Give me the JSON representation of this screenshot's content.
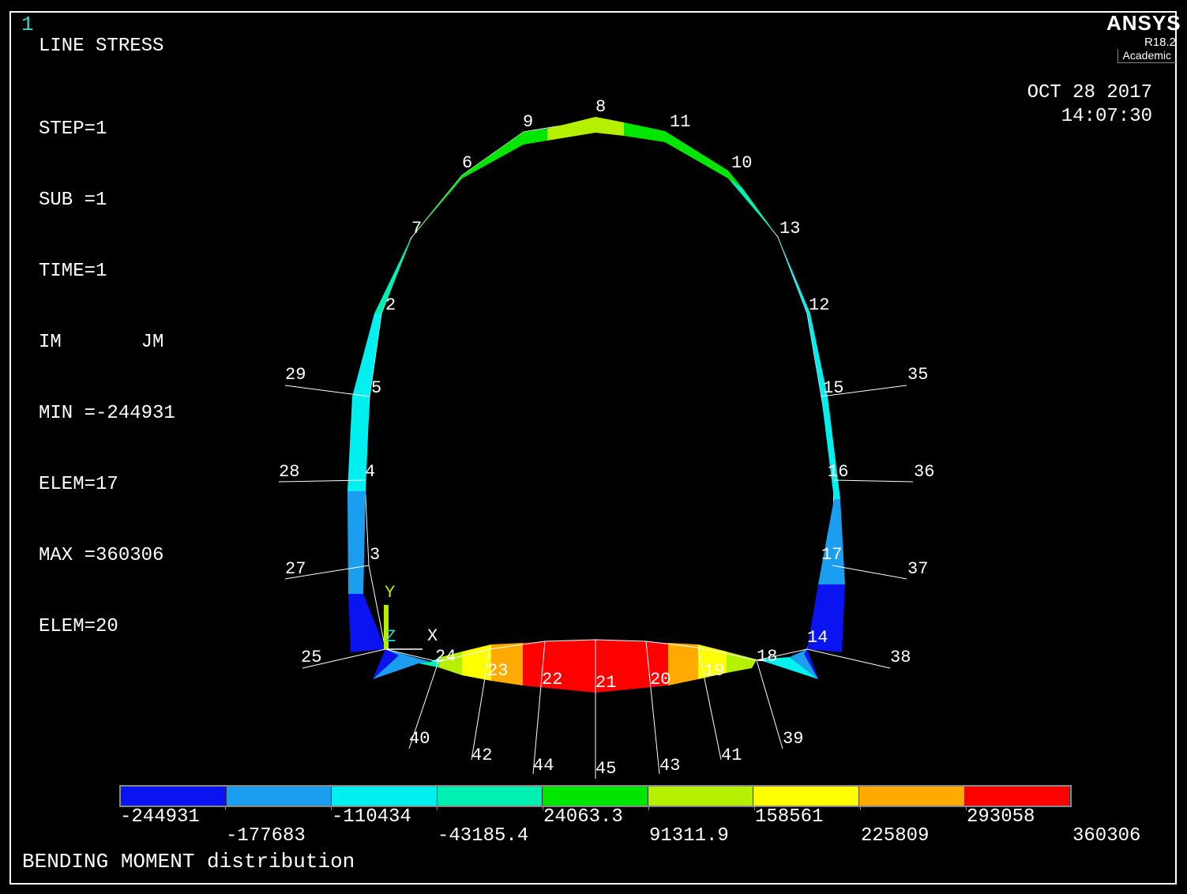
{
  "window_number": "1",
  "plot_title": "LINE STRESS",
  "info": {
    "step": "STEP=1",
    "sub": "SUB =1",
    "time": "TIME=1",
    "im_jm": "IM       JM",
    "min": "MIN =-244931",
    "min_elem": "ELEM=17",
    "max": "MAX =360306",
    "max_elem": "ELEM=20"
  },
  "date": "OCT 28 2017",
  "time": "14:07:30",
  "logo": {
    "name": "ANSYS",
    "version": "R18.2",
    "edition": "Academic"
  },
  "axis_triad": {
    "y": "Y",
    "z": "Z",
    "x": "X"
  },
  "legend": {
    "colors": [
      "#0a14f0",
      "#1c9ef0",
      "#00f0f0",
      "#00f0b4",
      "#00e600",
      "#b4f000",
      "#ffff00",
      "#ffaa00",
      "#ff0000"
    ],
    "values": [
      "-244931",
      "-177683",
      "-110434",
      "-43185.4",
      "24063.3",
      "91311.9",
      "158561",
      "225809",
      "293058",
      "360306"
    ]
  },
  "caption": "BENDING MOMENT distribution",
  "node_labels": {
    "n1": "8",
    "n2": "9",
    "n3": "11",
    "n4": "6",
    "n5": "10",
    "n6": "7",
    "n7": "13",
    "n8": "2",
    "n9": "12",
    "n10": "29",
    "n11": "5",
    "n12": "15",
    "n13": "35",
    "n14": "28",
    "n15": "4",
    "n16": "16",
    "n17": "36",
    "n18": "3",
    "n19": "27",
    "n20": "17",
    "n21": "37",
    "n22": "14",
    "n23": "25",
    "n24": "24",
    "n25": "23",
    "n26": "22",
    "n27": "21",
    "n28": "20",
    "n29": "19",
    "n30": "18",
    "n31": "38",
    "n32": "40",
    "n33": "42",
    "n34": "44",
    "n35": "45",
    "n36": "43",
    "n37": "41",
    "n38": "39"
  }
}
